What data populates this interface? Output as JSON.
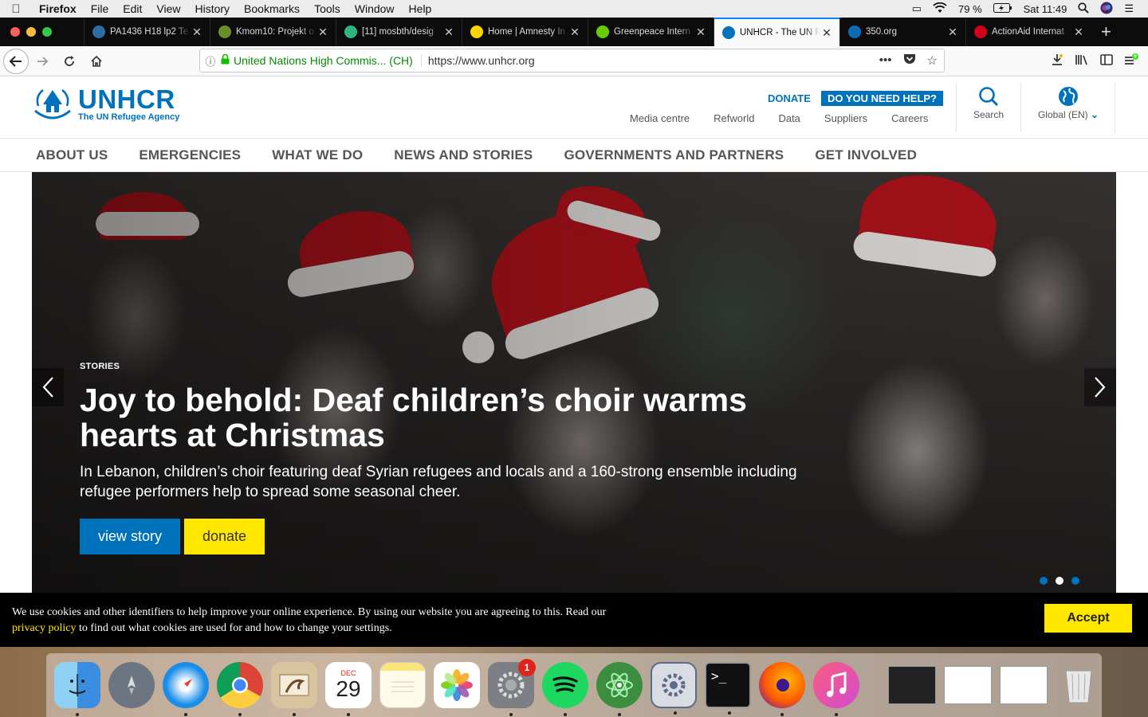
{
  "menubar": {
    "app": "Firefox",
    "items": [
      "File",
      "Edit",
      "View",
      "History",
      "Bookmarks",
      "Tools",
      "Window",
      "Help"
    ],
    "battery": "79 %",
    "clock": "Sat 11:49"
  },
  "tabs": [
    {
      "label": "PA1436 H18 lp2 Te",
      "favicon_color": "#2e6da4",
      "active": false
    },
    {
      "label": "Kmom10: Projekt o",
      "favicon_color": "#6a8f2a",
      "active": false
    },
    {
      "label": "[11] mosbth/desig",
      "favicon_color": "#2eb67d",
      "active": false
    },
    {
      "label": "Home | Amnesty In",
      "favicon_color": "#ffd400",
      "active": false
    },
    {
      "label": "Greenpeace Intern",
      "favicon_color": "#66cc00",
      "active": false
    },
    {
      "label": "UNHCR - The UN R",
      "favicon_color": "#0072bc",
      "active": true
    },
    {
      "label": "350.org",
      "favicon_color": "#0a6bb5",
      "active": false
    },
    {
      "label": "ActionAid Internat",
      "favicon_color": "#d0021b",
      "active": false
    }
  ],
  "urlbar": {
    "identity": "United Nations High Commis... (CH)",
    "url": "https://www.unhcr.org"
  },
  "site": {
    "logo_title": "UNHCR",
    "logo_sub": "The UN Refugee Agency",
    "donate_link": "DONATE",
    "help_button": "DO YOU NEED HELP?",
    "utility_nav": [
      "Media centre",
      "Refworld",
      "Data",
      "Suppliers",
      "Careers"
    ],
    "search_label": "Search",
    "global_label": "Global (EN)",
    "main_nav": [
      "ABOUT US",
      "EMERGENCIES",
      "WHAT WE DO",
      "NEWS AND STORIES",
      "GOVERNMENTS AND PARTNERS",
      "GET INVOLVED"
    ],
    "brand_color": "#0072bc",
    "accent_color": "#ffe700"
  },
  "hero": {
    "eyebrow": "STORIES",
    "title": "Joy to behold: Deaf children’s choir warms hearts at Christmas",
    "lede": "In Lebanon, children’s choir featuring deaf Syrian refugees and locals and a 160-strong ensemble including refugee performers help to spread some seasonal cheer.",
    "view_button": "view story",
    "donate_button": "donate",
    "slide_count": 3,
    "active_slide": 2
  },
  "cookie": {
    "text_before": "We use cookies and other identifiers to help improve your online experience. By using our website you are agreeing to this. Read our",
    "link": "privacy policy",
    "text_after": "to find out what cookies are used for and how to change your settings.",
    "accept": "Accept"
  },
  "dock": {
    "calendar_month": "DEC",
    "calendar_day": "29",
    "settings_badge": "1"
  }
}
